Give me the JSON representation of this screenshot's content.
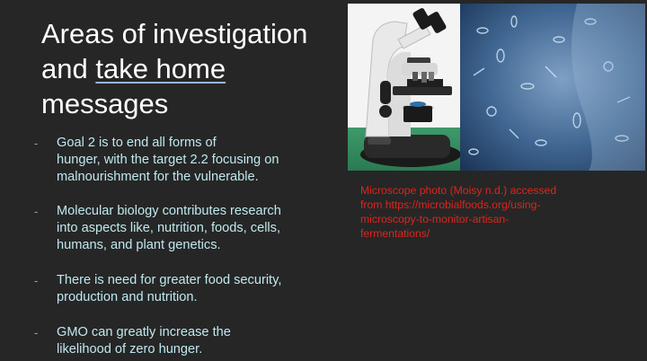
{
  "slide": {
    "title_line1": "Areas of investigation",
    "title_line2_prefix": "and ",
    "title_line2_link": "take home",
    "title_line3": "messages"
  },
  "bullets": [
    {
      "dash": "-",
      "line1": "Goal 2 is to end all forms of",
      "line2": "hunger,  with the target 2.2 focusing on",
      "line3": "malnourishment for the vulnerable."
    },
    {
      "dash": "-",
      "line1": "Molecular biology contributes research",
      "line2": "into aspects like, nutrition, foods, cells,",
      "line3": "humans, and plant genetics."
    },
    {
      "dash": "-",
      "line1": "There is need for greater food security,",
      "line2": "production and nutrition."
    },
    {
      "dash": "-",
      "line1": "GMO can greatly increase the",
      "line2": "likelihood of zero hunger."
    }
  ],
  "caption": {
    "line1": "Microscope photo (Moisy n.d.) accessed",
    "line2": "from https://microbialfoods.org/using-",
    "line3": "microscopy-to-monitor-artisan-",
    "line4": "fermentations/"
  },
  "colors": {
    "background": "#262626",
    "title": "#ffffff",
    "body_text": "#bfe9ef",
    "caption": "#e0241c"
  },
  "icons": {
    "microscope": "microscope-image",
    "micrograph": "fermentation-micrograph"
  }
}
